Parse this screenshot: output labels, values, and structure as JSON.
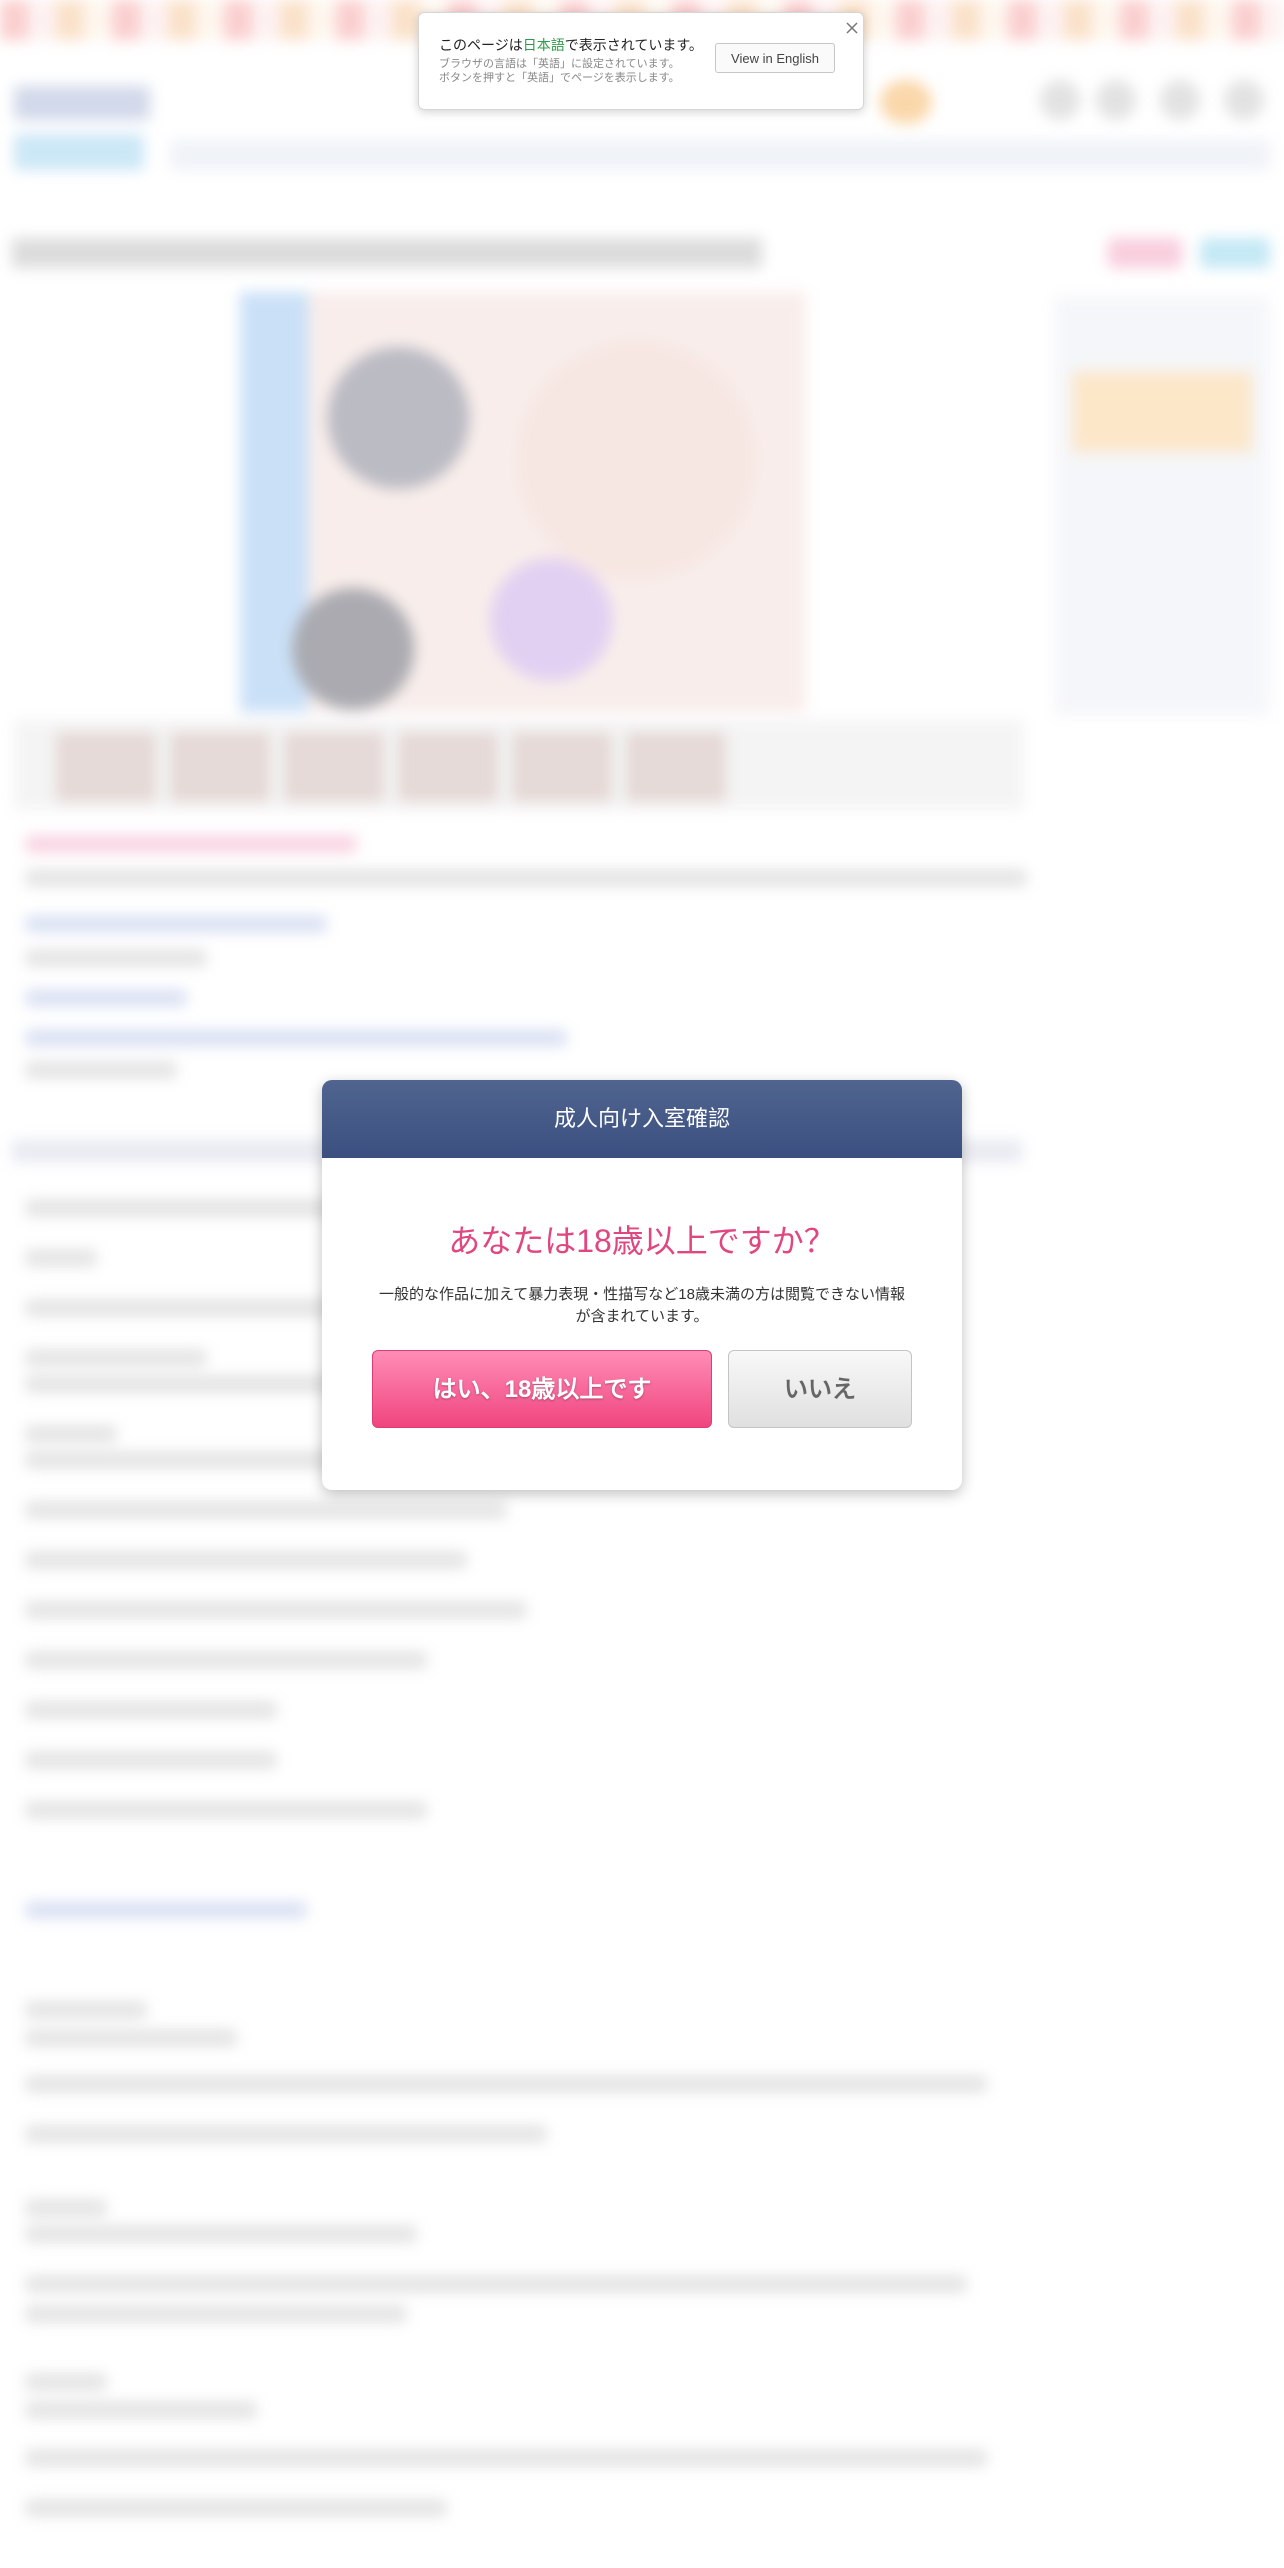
{
  "translate_bar": {
    "message_prefix": "このページは",
    "language": "日本語",
    "message_suffix": "で表示されています。",
    "sub_line1": "ブラウザの言語は「英語」に設定されています。",
    "sub_line2": "ボタンを押すと「英語」でページを表示します。",
    "button_label": "View in English",
    "close_icon": "close-icon"
  },
  "age_modal": {
    "title": "成人向け入室確認",
    "question": "あなたは18歳以上ですか？",
    "description": "一般的な作品に加えて暴力表現・性描写など18歳未満の方は閲覧できない情報が含まれています。",
    "yes_label": "はい、18歳以上です",
    "no_label": "いいえ"
  },
  "colors": {
    "modal_header": "#3b5080",
    "accent_pink": "#e0467f",
    "language_green": "#2e9a49"
  }
}
